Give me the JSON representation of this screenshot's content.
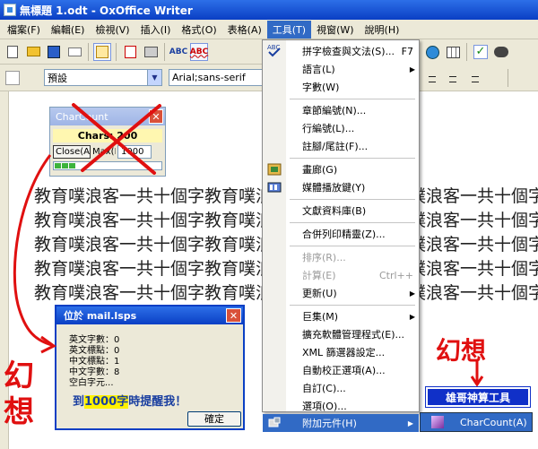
{
  "window": {
    "title": "無標題 1.odt - OxOffice Writer"
  },
  "menubar": [
    "檔案(F)",
    "編輯(E)",
    "檢視(V)",
    "插入(I)",
    "格式(O)",
    "表格(A)",
    "工具(T)",
    "視窗(W)",
    "說明(H)"
  ],
  "formatting": {
    "style_value": "預設",
    "font_value": "Arial;sans-serif"
  },
  "document": {
    "lines": [
      "教育噗浪客一共十個字教育噗浪客一共十個字教育噗浪客一共十個字",
      "教育噗浪客一共十個字教育噗浪客一共十個字教育噗浪客一共十個字",
      "教育噗浪客一共十個字教育噗浪客一共十個字教育噗浪客一共十個字",
      "教育噗浪客一共十個字教育噗浪客一共十個字教育噗浪客一共十個字",
      "教育噗浪客一共十個字教育噗浪客一共十個字教育噗浪客一共十個字"
    ]
  },
  "charcount": {
    "title": "CharCount",
    "chars_text": "Chars: 200",
    "close_button": "Close(A)",
    "max_label": "Max(F)",
    "max_value": "1000"
  },
  "tools_menu": {
    "items": [
      {
        "label": "拼字檢查與文法(S)...",
        "accel": "F7"
      },
      {
        "label": "語言(L)",
        "submenu": true
      },
      {
        "label": "字數(W)"
      },
      {
        "label": "章節編號(N)..."
      },
      {
        "label": "行編號(L)..."
      },
      {
        "label": "註腳/尾註(F)..."
      },
      {
        "label": "畫廊(G)"
      },
      {
        "label": "媒體播放鍵(Y)"
      },
      {
        "label": "文獻資料庫(B)"
      },
      {
        "label": "合併列印精靈(Z)..."
      },
      {
        "label": "排序(R)...",
        "disabled": true
      },
      {
        "label": "計算(E)",
        "accel": "Ctrl++",
        "disabled": true
      },
      {
        "label": "更新(U)",
        "submenu": true
      },
      {
        "label": "巨集(M)",
        "submenu": true
      },
      {
        "label": "擴充軟體管理程式(E)..."
      },
      {
        "label": "XML 篩選器設定..."
      },
      {
        "label": "自動校正選項(A)..."
      },
      {
        "label": "自訂(C)..."
      },
      {
        "label": "選項(O)..."
      },
      {
        "label": "附加元件(H)",
        "submenu": true,
        "highlight": true
      }
    ],
    "submenu_item": "CharCount(A)"
  },
  "dialog": {
    "title": "位於 mail.lsps",
    "lines": [
      "英文字數：0",
      "英文標點：0",
      "中文標點：1",
      "中文字數：8",
      "空白字元..."
    ],
    "warning_prefix": "到",
    "warning_highlight": "1000字",
    "warning_suffix": "時提醒我！",
    "ok_button": "確定"
  },
  "annotations": {
    "fantasy_left": "幻想",
    "fantasy_right": "幻想",
    "tool_label": "雄哥神算工具",
    "annotation_color": "#e01010"
  }
}
